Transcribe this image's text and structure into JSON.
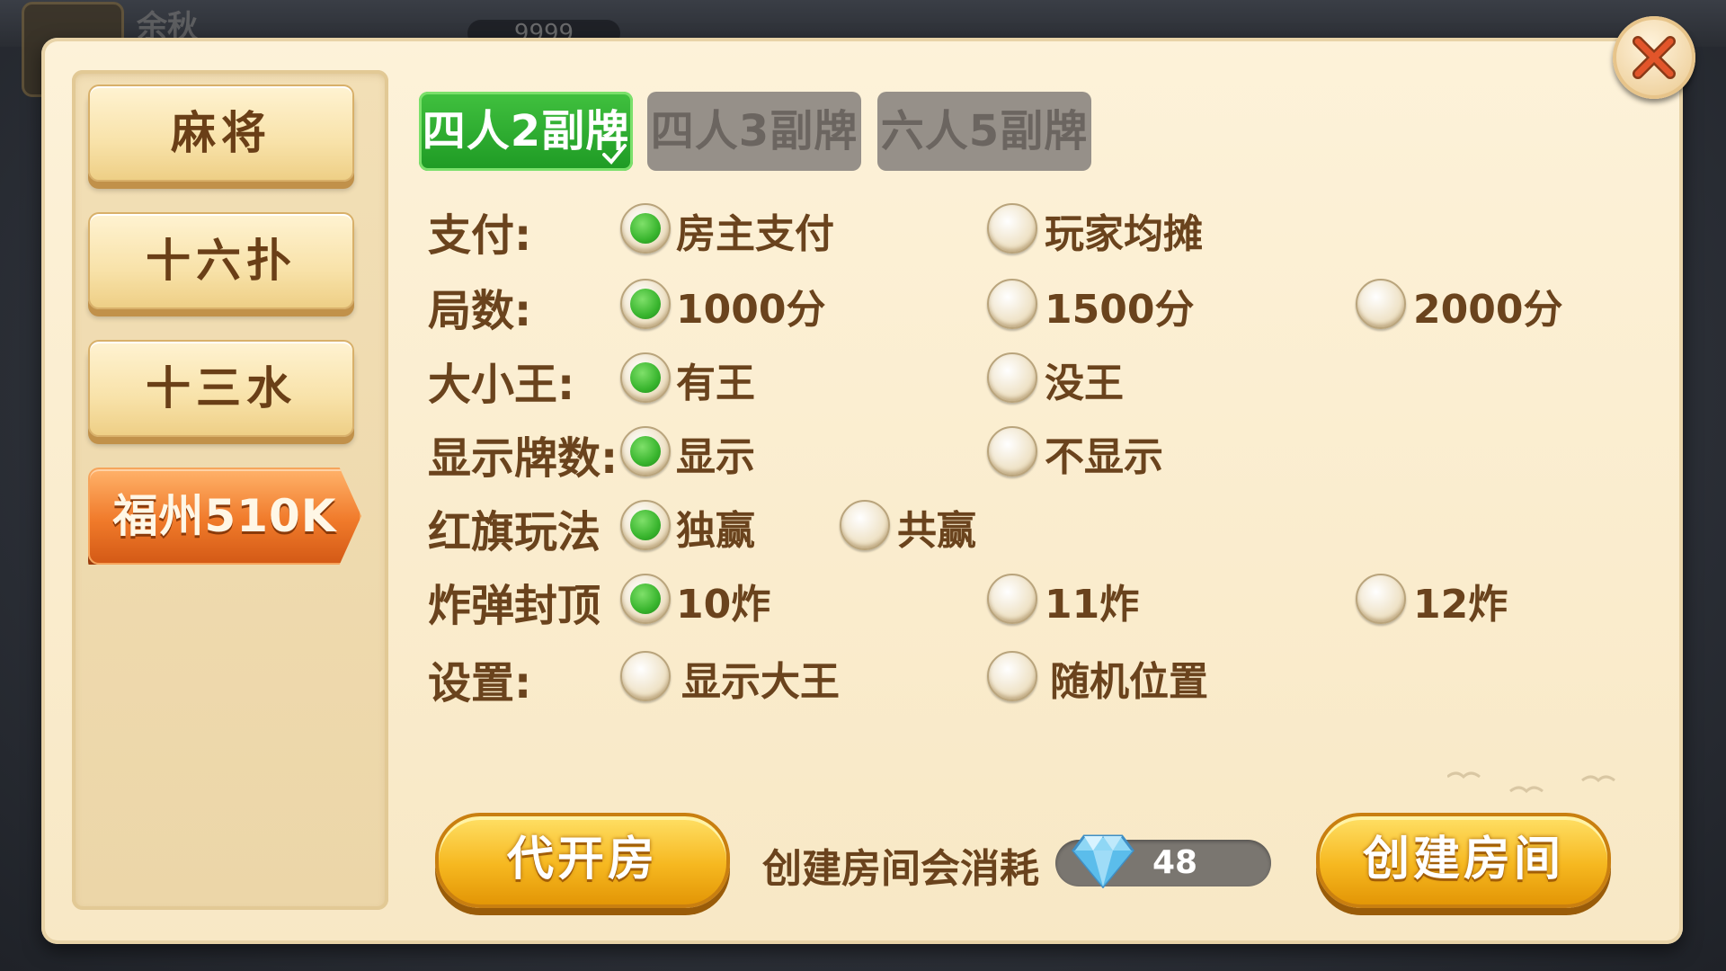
{
  "background": {
    "player_name": "余秋",
    "score": "9999"
  },
  "sidebar": {
    "items": [
      {
        "label": "麻将"
      },
      {
        "label": "十六扑"
      },
      {
        "label": "十三水"
      },
      {
        "label": "福州510K",
        "active": true
      }
    ]
  },
  "tabs": [
    {
      "label": "四人2副牌",
      "active": true
    },
    {
      "label": "四人3副牌",
      "active": false
    },
    {
      "label": "六人5副牌",
      "active": false
    }
  ],
  "settings": [
    {
      "label": "支付:",
      "options": [
        {
          "label": "房主支付",
          "selected": true
        },
        {
          "label": "玩家均摊",
          "selected": false
        }
      ]
    },
    {
      "label": "局数:",
      "options": [
        {
          "label": "1000分",
          "selected": true
        },
        {
          "label": "1500分",
          "selected": false
        },
        {
          "label": "2000分",
          "selected": false
        }
      ]
    },
    {
      "label": "大小王:",
      "options": [
        {
          "label": "有王",
          "selected": true
        },
        {
          "label": "没王",
          "selected": false
        }
      ]
    },
    {
      "label": "显示牌数:",
      "options": [
        {
          "label": "显示",
          "selected": true
        },
        {
          "label": "不显示",
          "selected": false
        }
      ]
    },
    {
      "label": "红旗玩法",
      "options": [
        {
          "label": "独赢",
          "selected": true
        },
        {
          "label": "共赢",
          "selected": false
        }
      ]
    },
    {
      "label": "炸弹封顶",
      "options": [
        {
          "label": "10炸",
          "selected": true
        },
        {
          "label": "11炸",
          "selected": false
        },
        {
          "label": "12炸",
          "selected": false
        }
      ]
    },
    {
      "label": "设置:",
      "options": [
        {
          "label": "显示大王",
          "selected": false
        },
        {
          "label": "随机位置",
          "selected": false
        }
      ]
    }
  ],
  "footer": {
    "proxy_button": "代开房",
    "cost_text": "创建房间会消耗",
    "diamond_cost": "48",
    "create_button": "创建房间"
  },
  "icons": {
    "close": "close-icon",
    "diamond": "diamond-icon",
    "check": "check-icon"
  },
  "colors": {
    "active_tab": "#2aa92c",
    "active_sidebar": "#f07a2a",
    "selected_radio": "#39b52e",
    "label_text": "#6a431d",
    "primary_button": "#f6b820"
  }
}
